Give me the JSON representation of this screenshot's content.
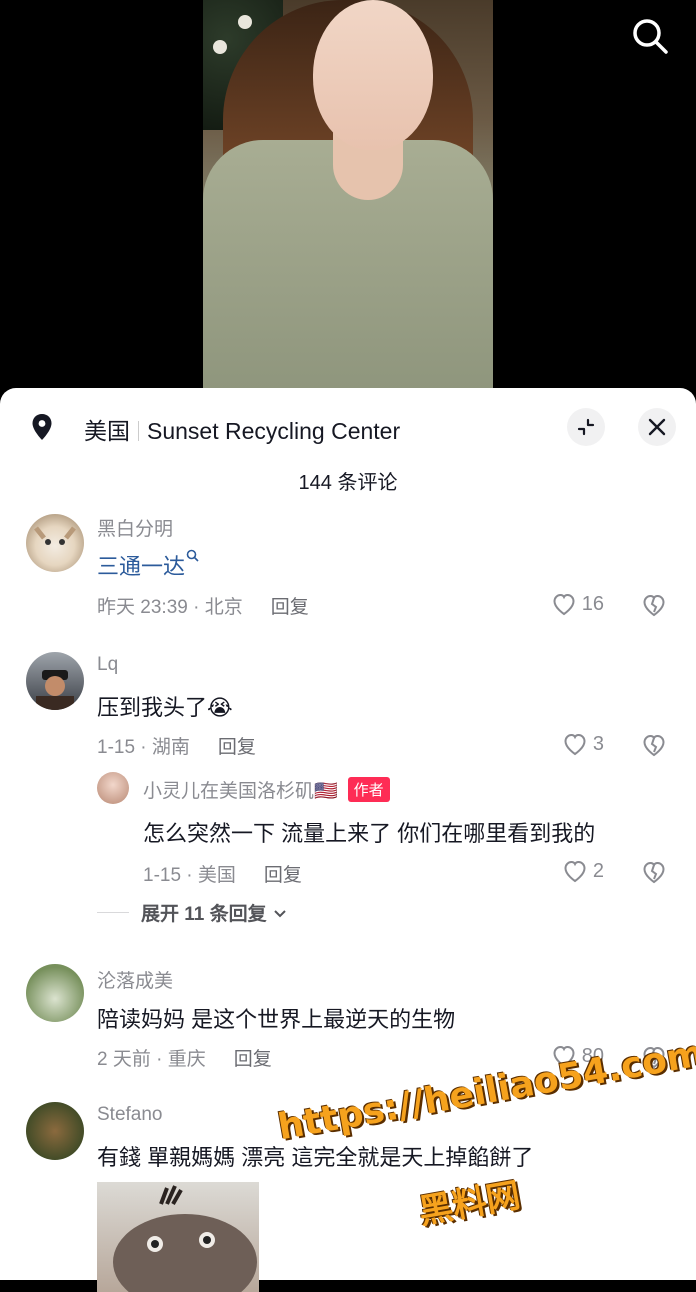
{
  "header": {
    "location_country": "美国",
    "location_place": "Sunset Recycling Center"
  },
  "comments_count": "144 条评论",
  "comments": [
    {
      "user": "黑白分明",
      "text": "三通一达",
      "meta": "昨天 23:39 · 北京",
      "reply": "回复",
      "likes": "16"
    },
    {
      "user": "Lq",
      "text": "压到我头了😭",
      "meta": "1-15 · 湖南",
      "reply": "回复",
      "likes": "3"
    },
    {
      "user": "小灵儿在美国洛杉矶🇺🇸",
      "badge": "作者",
      "text": "怎么突然一下 流量上来了 你们在哪里看到我的",
      "meta": "1-15 · 美国",
      "reply": "回复",
      "likes": "2"
    },
    {
      "user": "沦落成美",
      "text": "陪读妈妈 是这个世界上最逆天的生物",
      "meta": "2 天前 · 重庆",
      "reply": "回复",
      "likes": "80"
    },
    {
      "user": "Stefano",
      "text": "有錢 單親媽媽 漂亮 這完全就是天上掉餡餅了"
    }
  ],
  "expand_replies": "展开 11 条回复",
  "watermark": {
    "url": "https://heiliao54.com",
    "name": "黑料网"
  },
  "colors": {
    "author_badge": "#fe2c55",
    "link": "#2c5b9b",
    "watermark": "#f6a21d"
  },
  "icons": [
    "search-icon",
    "location-pin-icon",
    "collapse-icon",
    "close-icon",
    "heart-icon",
    "broken-heart-icon",
    "chevron-down-icon"
  ]
}
